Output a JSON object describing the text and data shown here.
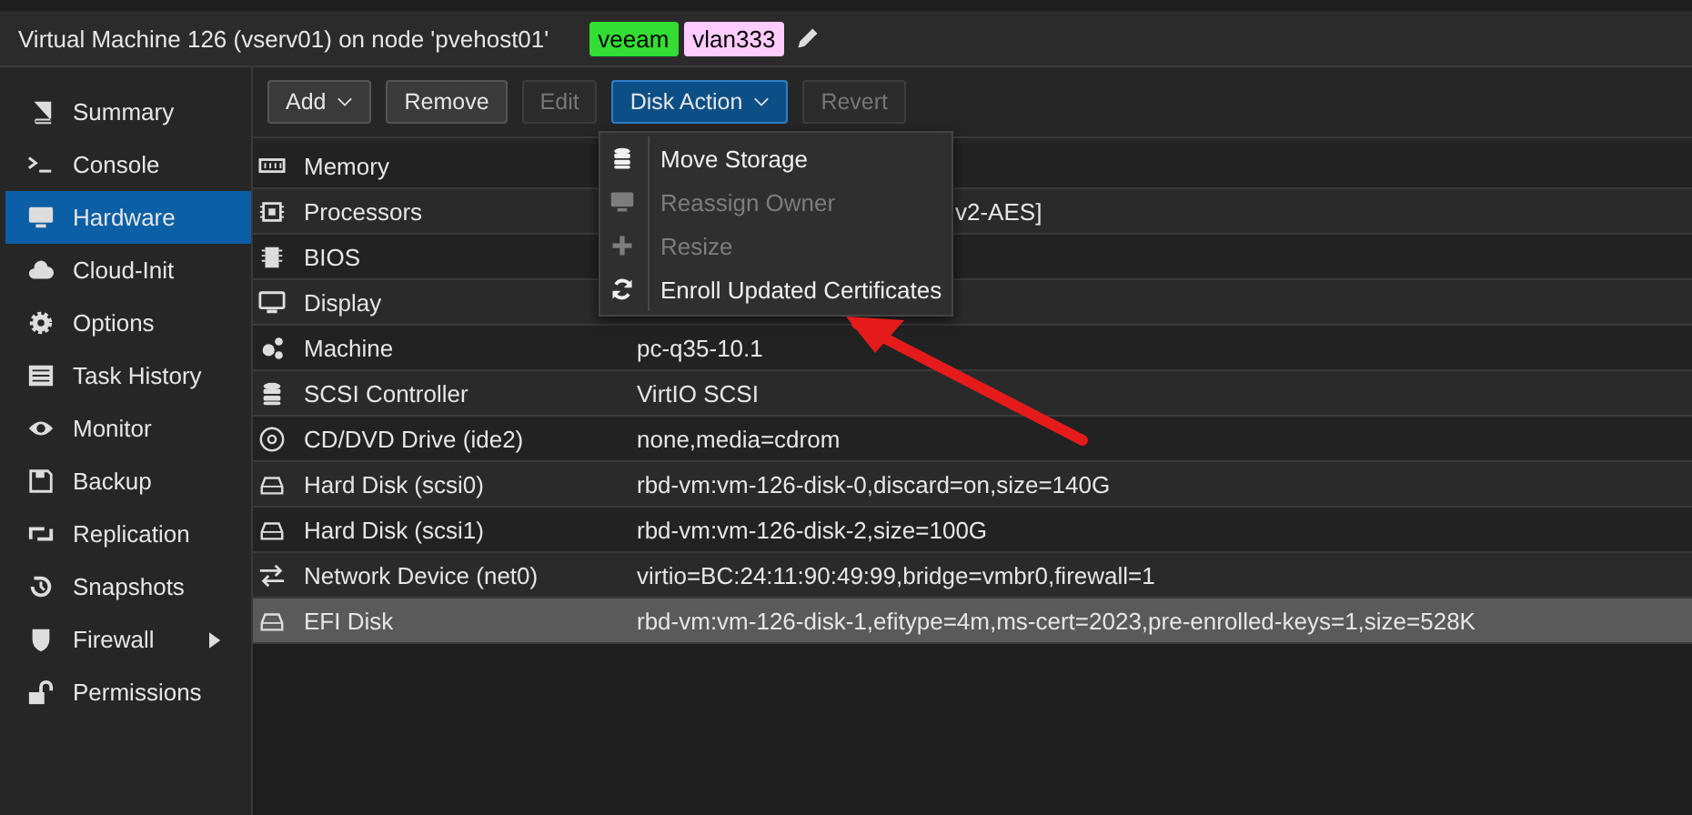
{
  "header": {
    "title": "Virtual Machine 126 (vserv01) on node 'pvehost01'",
    "tags": [
      {
        "label": "veeam",
        "color": "#33dd33"
      },
      {
        "label": "vlan333",
        "color": "#ffccff"
      }
    ]
  },
  "sidebar": {
    "items": [
      {
        "label": "Summary",
        "selected": false
      },
      {
        "label": "Console",
        "selected": false
      },
      {
        "label": "Hardware",
        "selected": true
      },
      {
        "label": "Cloud-Init",
        "selected": false
      },
      {
        "label": "Options",
        "selected": false
      },
      {
        "label": "Task History",
        "selected": false
      },
      {
        "label": "Monitor",
        "selected": false
      },
      {
        "label": "Backup",
        "selected": false
      },
      {
        "label": "Replication",
        "selected": false
      },
      {
        "label": "Snapshots",
        "selected": false
      },
      {
        "label": "Firewall",
        "selected": false,
        "submenu": true
      },
      {
        "label": "Permissions",
        "selected": false
      }
    ]
  },
  "toolbar": [
    {
      "label": "Add",
      "disabled": false,
      "dropdown": true,
      "pressed": false
    },
    {
      "label": "Remove",
      "disabled": false,
      "dropdown": false,
      "pressed": false
    },
    {
      "label": "Edit",
      "disabled": true,
      "dropdown": false,
      "pressed": false
    },
    {
      "label": "Disk Action",
      "disabled": false,
      "dropdown": true,
      "pressed": true
    },
    {
      "label": "Revert",
      "disabled": true,
      "dropdown": false,
      "pressed": false
    }
  ],
  "table": {
    "rows": [
      {
        "name": "Memory",
        "selected": false
      },
      {
        "name": "Processors",
        "value": "v2-AES]",
        "covered": true,
        "selected": false
      },
      {
        "name": "BIOS",
        "selected": false
      },
      {
        "name": "Display",
        "selected": false
      },
      {
        "name": "Machine",
        "value": "pc-q35-10.1",
        "selected": false
      },
      {
        "name": "SCSI Controller",
        "value": "VirtIO SCSI",
        "selected": false
      },
      {
        "name": "CD/DVD Drive (ide2)",
        "value": "none,media=cdrom",
        "selected": false
      },
      {
        "name": "Hard Disk (scsi0)",
        "value": "rbd-vm:vm-126-disk-0,discard=on,size=140G",
        "selected": false
      },
      {
        "name": "Hard Disk (scsi1)",
        "value": "rbd-vm:vm-126-disk-2,size=100G",
        "selected": false
      },
      {
        "name": "Network Device (net0)",
        "value": "virtio=BC:24:11:90:49:99,bridge=vmbr0,firewall=1",
        "selected": false
      },
      {
        "name": "EFI Disk",
        "value": "rbd-vm:vm-126-disk-1,efitype=4m,ms-cert=2023,pre-enrolled-keys=1,size=528K",
        "selected": true
      }
    ]
  },
  "dropdown_menu": {
    "items": [
      {
        "label": "Move Storage",
        "disabled": false
      },
      {
        "label": "Reassign Owner",
        "disabled": true
      },
      {
        "label": "Resize",
        "disabled": true
      },
      {
        "label": "Enroll Updated Certificates",
        "disabled": false
      }
    ]
  },
  "annotation": {
    "kind": "arrow"
  }
}
